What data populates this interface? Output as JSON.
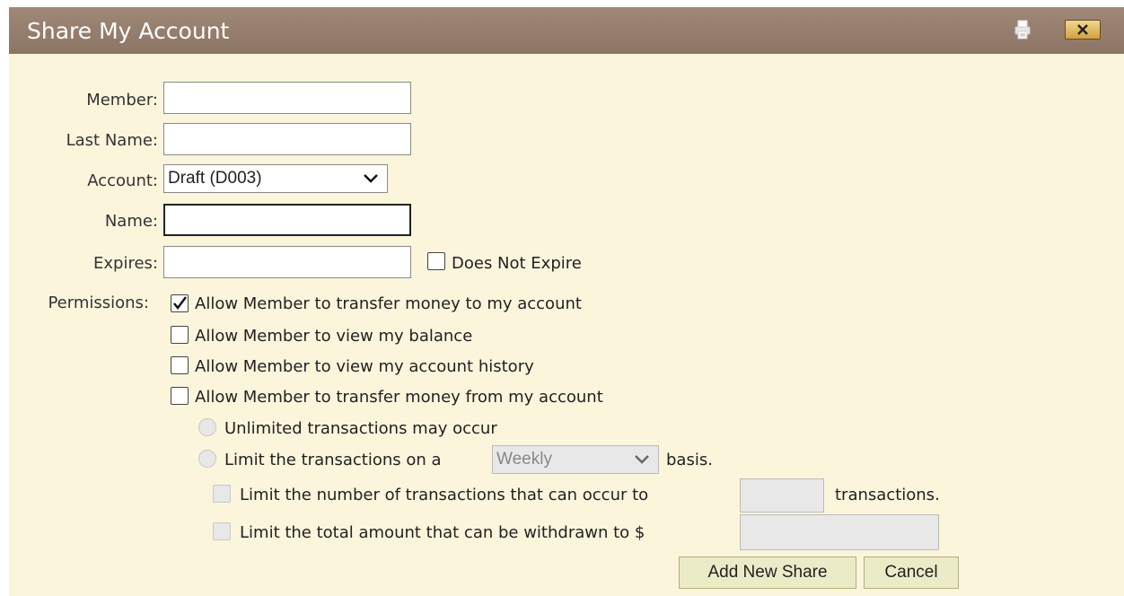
{
  "window": {
    "title": "Share My Account"
  },
  "form": {
    "member_label": "Member:",
    "member_value": "",
    "last_name_label": "Last Name:",
    "last_name_value": "",
    "account_label": "Account:",
    "account_selected": "Draft (D003)",
    "name_label": "Name:",
    "name_value": "",
    "expires_label": "Expires:",
    "expires_value": "",
    "does_not_expire_label": "Does Not Expire",
    "does_not_expire_checked": false,
    "permissions_label": "Permissions:"
  },
  "permissions": [
    {
      "label": "Allow Member to transfer money to my account",
      "checked": true
    },
    {
      "label": "Allow Member to view my balance",
      "checked": false
    },
    {
      "label": "Allow Member to view my account history",
      "checked": false
    },
    {
      "label": "Allow Member to transfer money from my account",
      "checked": false
    }
  ],
  "transfer_options": {
    "unlimited_label": "Unlimited transactions may occur",
    "limit_basis_prefix": "Limit the transactions on a",
    "basis_selected": "Weekly",
    "limit_basis_suffix": "basis.",
    "limit_count_prefix": "Limit the number of transactions that can occur to",
    "limit_count_suffix": "transactions.",
    "limit_amount_prefix": "Limit the total amount that can be withdrawn to $"
  },
  "buttons": {
    "add_label": "Add New Share",
    "cancel_label": "Cancel"
  },
  "icons": {
    "print": "printer-icon",
    "close": "close-icon"
  },
  "colors": {
    "titlebar": "#8d7565",
    "dialog_background": "#fbf5dc",
    "button_background": "#ecebc8"
  }
}
